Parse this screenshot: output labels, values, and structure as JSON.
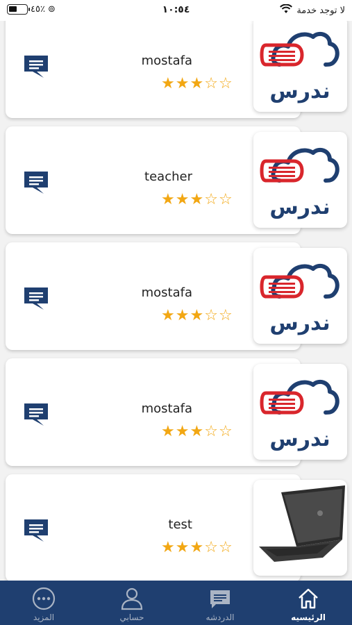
{
  "status_bar": {
    "battery": "٤٥٪",
    "time": "١٠:٥٤",
    "carrier": "لا توجد خدمة"
  },
  "teachers": [
    {
      "name": "mostafa",
      "rating": 3,
      "max_rating": 5,
      "image": "nadrus-logo"
    },
    {
      "name": "teacher",
      "rating": 3,
      "max_rating": 5,
      "image": "nadrus-logo"
    },
    {
      "name": "mostafa",
      "rating": 3,
      "max_rating": 5,
      "image": "nadrus-logo"
    },
    {
      "name": "mostafa",
      "rating": 3,
      "max_rating": 5,
      "image": "nadrus-logo"
    },
    {
      "name": "test",
      "rating": 3,
      "max_rating": 5,
      "image": "laptop-photo"
    }
  ],
  "logo": {
    "wordmark": "ندرس",
    "cloud_color": "#1f3f70",
    "book_color": "#d9262c"
  },
  "bottom_nav": {
    "items": [
      {
        "label": "الرئيسيه",
        "icon": "home-icon",
        "active": true
      },
      {
        "label": "الدردشه",
        "icon": "chat-icon",
        "active": false
      },
      {
        "label": "حسابي",
        "icon": "profile-icon",
        "active": false
      },
      {
        "label": "المزيد",
        "icon": "more-icon",
        "active": false
      }
    ]
  },
  "colors": {
    "nav_bg": "#1f3f70",
    "star": "#f2a713",
    "chat_icon": "#1f3f70"
  }
}
